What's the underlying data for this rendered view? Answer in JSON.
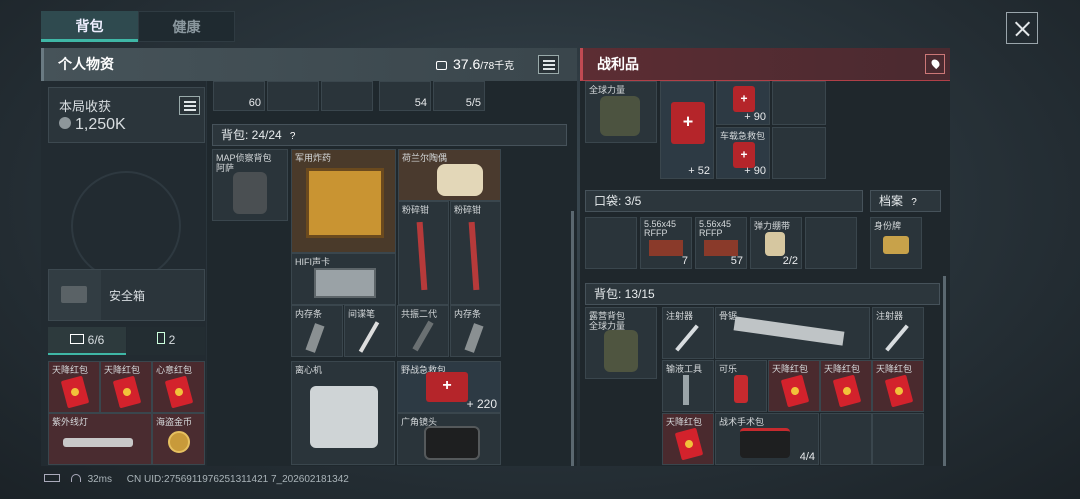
{
  "tabs": [
    "背包",
    "健康"
  ],
  "personal": {
    "title": "个人物资",
    "weight": "37.6",
    "weight_max": "/78千克",
    "income_label": "本局收获",
    "income_value": "1,250K",
    "safe_box": "安全箱",
    "tab_a": "6/6",
    "tab_b": "2",
    "top_counts": [
      "60",
      "54",
      "5/5"
    ]
  },
  "backpack": {
    "label": "背包: 24/24",
    "items": [
      "MAP侦察背包",
      "阿萨",
      "军用炸药",
      "荷兰尔陶偶",
      "粉碎钳",
      "粉碎钳",
      "HIFI声卡",
      "内存条",
      "间谍笔",
      "共振二代",
      "内存条",
      "离心机",
      "野战急救包",
      "广角镜头"
    ],
    "medkit_count": "220"
  },
  "safe_items": [
    "天降红包",
    "天降红包",
    "心意红包",
    "紫外线灯",
    "海盗金币"
  ],
  "loot": {
    "title": "战利品",
    "top_label": "全球力量",
    "car_kit": "车载急救包",
    "counts": [
      "90",
      "52",
      "90"
    ],
    "pocket_label": "口袋: 3/5",
    "archive_label": "档案",
    "pocket_items": [
      "5.56x45",
      "RFFP",
      "5.56x45",
      "RFFP",
      "弹力绷带",
      "身份牌"
    ],
    "pocket_counts": [
      "7",
      "57",
      "2/2"
    ],
    "bag_label": "背包: 13/15",
    "bag_items": [
      "露营背包",
      "全球力量",
      "注射器",
      "骨锯",
      "注射器",
      "输液工具",
      "可乐",
      "天降红包",
      "天降红包",
      "天降红包",
      "天降红包",
      "战术手术包"
    ],
    "surgery_count": "4/4"
  },
  "status": {
    "ping": "32ms",
    "uid": "CN UID:2756911976251311421 7_202602181342"
  }
}
